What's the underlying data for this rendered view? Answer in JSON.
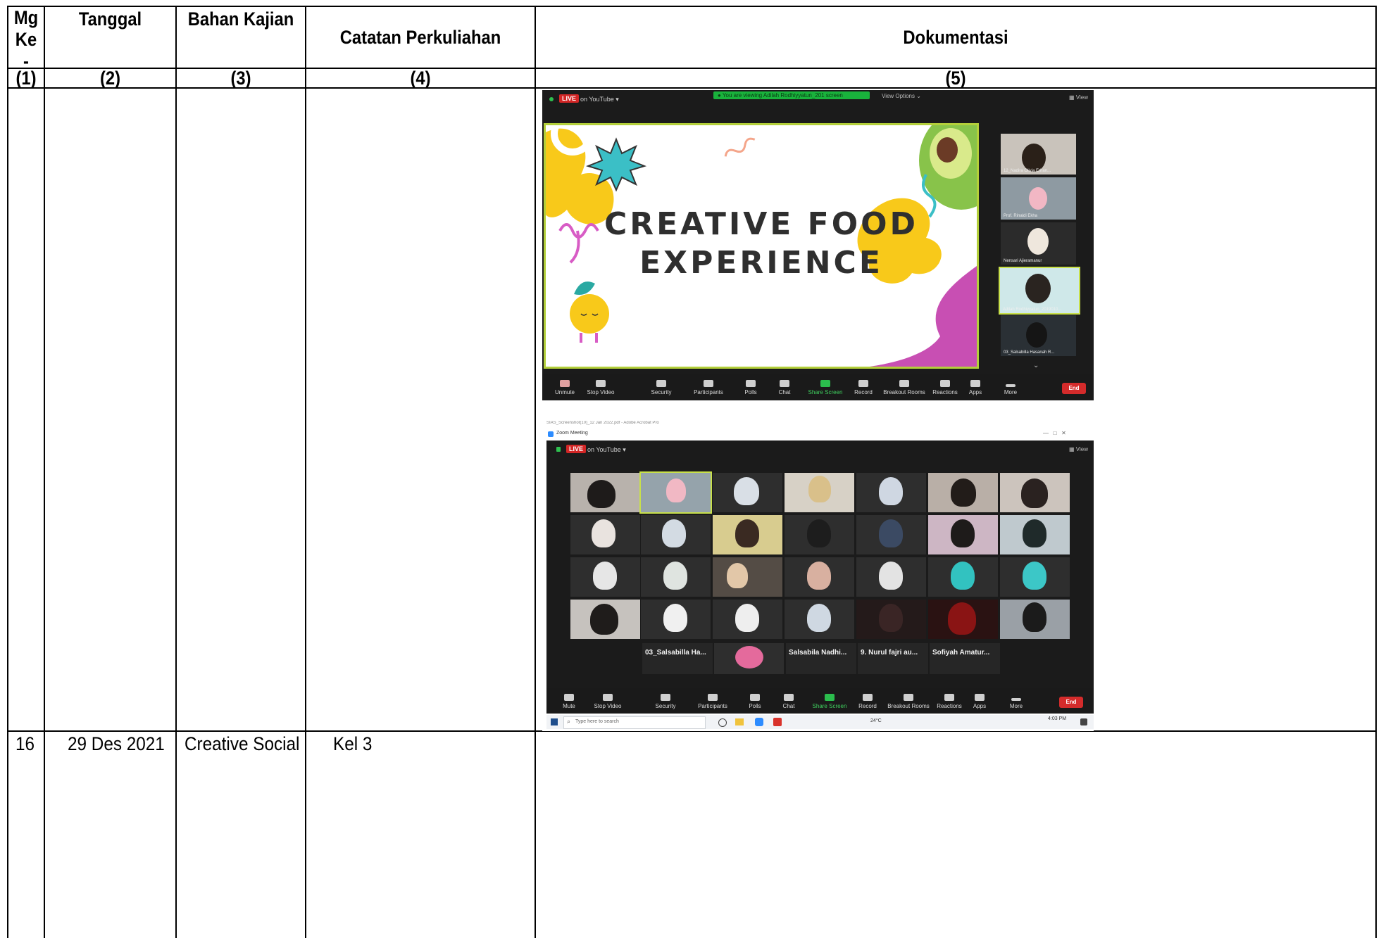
{
  "table": {
    "headers": [
      {
        "id": "mg",
        "label": "Mg Ke -"
      },
      {
        "id": "tanggal",
        "label": "Tanggal"
      },
      {
        "id": "bahan",
        "label": "Bahan Kajian"
      },
      {
        "id": "catatan",
        "label": "Catatan Perkuliahan"
      },
      {
        "id": "dok",
        "label": "Dokumentasi"
      }
    ],
    "header_lines": {
      "mg1": "Mg",
      "mg2": "Ke",
      "mg3": "-"
    },
    "numbers": [
      "(1)",
      "(2)",
      "(3)",
      "(4)",
      "(5)"
    ],
    "row": {
      "mg": "16",
      "tanggal": "29 Des 2021",
      "bahan": "Creative Social",
      "catatan": "Kel 3"
    }
  },
  "screenshot1": {
    "live_label": "LIVE",
    "youtube_label": "on YouTube ▾",
    "banner_text": "● You are viewing Adilah Rodhiyyatun_201 screen",
    "view_options": "View Options ⌄",
    "view_label": "▦ View",
    "slide_line1": "CREATIVE FOOD",
    "slide_line2": "EXPERIENCE",
    "thumbnails": [
      "12_Nadira Olivia Erhan...",
      "Prof. Rinaldi Ekha",
      "Nensari Ajieramanur",
      "Adilah Rodhiyyatun_2019010...",
      "03_Salsabilla Hasanah R..."
    ],
    "toolbar": [
      "Unmute",
      "Stop Video",
      "Security",
      "Participants",
      "Polls",
      "Chat",
      "Share Screen",
      "Record",
      "Breakout Rooms",
      "Reactions",
      "Apps",
      "More"
    ],
    "end_label": "End"
  },
  "screenshot2": {
    "window_title": "SIAS_Screenshot(10)_12 Jan 2022.pdf - Adobe Acrobat Pro",
    "zoom_title": "Zoom Meeting",
    "live_label": "LIVE",
    "youtube_label": "on YouTube ▾",
    "view_label": "▦ View",
    "participant_names": [
      "03_Salsabilla Ha...",
      "Salsabila Nadhi...",
      "9. Nurul fajri au...",
      "Sofiyah Amatur..."
    ],
    "toolbar": [
      "Mute",
      "Stop Video",
      "Security",
      "Participants",
      "Polls",
      "Chat",
      "Share Screen",
      "Record",
      "Breakout Rooms",
      "Reactions",
      "Apps",
      "More"
    ],
    "end_label": "End",
    "search_placeholder": "Type here to search",
    "weather": "24°C",
    "clock": "4:03 PM"
  }
}
